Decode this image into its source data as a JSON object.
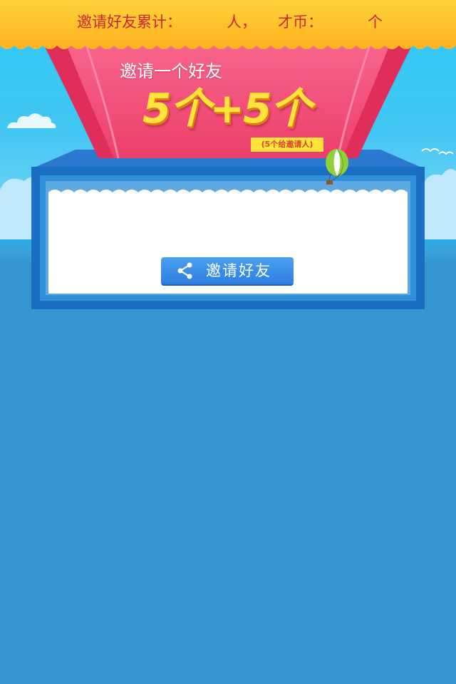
{
  "stats": {
    "label_invited": "邀请好友累计：",
    "invited_count": "",
    "unit_people": "人，",
    "label_coins": "才币：",
    "coins_count": "",
    "unit_coins": "个"
  },
  "promo": {
    "title": "邀请一个好友",
    "reward": "5个+5个",
    "note": "(5个给邀请人)"
  },
  "action": {
    "invite_label": "邀请好友",
    "icon": "share-icon"
  },
  "colors": {
    "banner_yellow": "#ffc52a",
    "curtain_pink": "#f2507a",
    "reward_yellow": "#ffe23a",
    "stat_red": "#c6282e",
    "button_blue": "#2c7fe0",
    "background_blue": "#3595cf"
  }
}
